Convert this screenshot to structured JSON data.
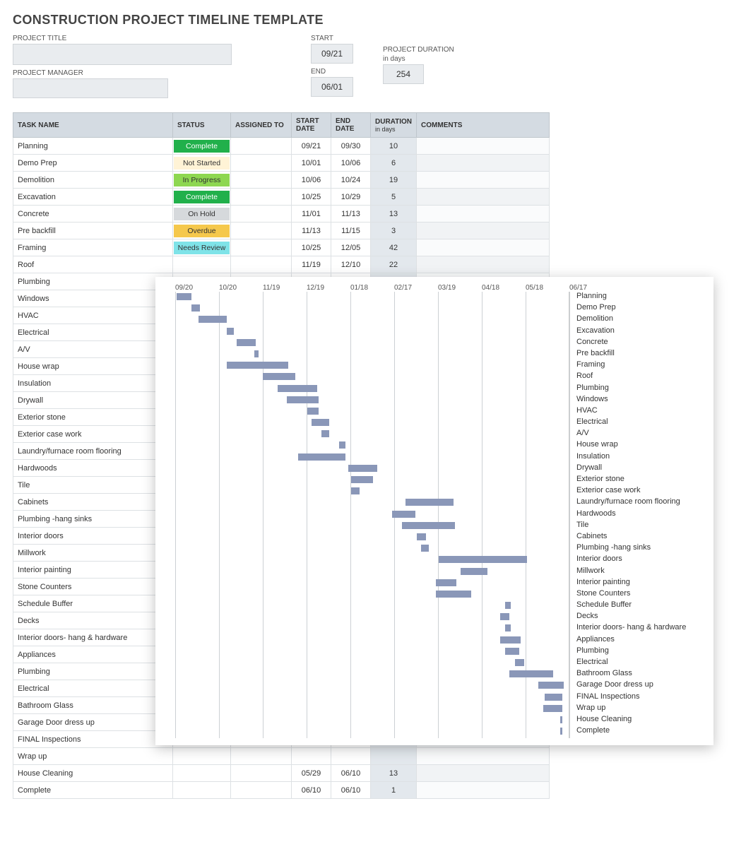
{
  "title": "CONSTRUCTION PROJECT TIMELINE TEMPLATE",
  "labels": {
    "project_title": "PROJECT TITLE",
    "project_manager": "PROJECT MANAGER",
    "start": "START",
    "end": "END",
    "project_duration": "PROJECT DURATION",
    "in_days": "in days"
  },
  "values": {
    "project_title": "",
    "project_manager": "",
    "start": "09/21",
    "end": "06/01",
    "duration": "254"
  },
  "headers": {
    "task_name": "TASK NAME",
    "status": "STATUS",
    "assigned_to": "ASSIGNED TO",
    "start_date": "START DATE",
    "end_date": "END DATE",
    "duration": "DURATION",
    "duration_sub": "in days",
    "comments": "COMMENTS"
  },
  "status_labels": {
    "complete": "Complete",
    "notstarted": "Not Started",
    "inprogress": "In Progress",
    "onhold": "On Hold",
    "overdue": "Overdue",
    "needsreview": "Needs Review"
  },
  "tasks": [
    {
      "name": "Planning",
      "status": "complete",
      "start": "09/21",
      "end": "09/30",
      "dur": "10"
    },
    {
      "name": "Demo Prep",
      "status": "notstarted",
      "start": "10/01",
      "end": "10/06",
      "dur": "6"
    },
    {
      "name": "Demolition",
      "status": "inprogress",
      "start": "10/06",
      "end": "10/24",
      "dur": "19"
    },
    {
      "name": "Excavation",
      "status": "complete",
      "start": "10/25",
      "end": "10/29",
      "dur": "5"
    },
    {
      "name": "Concrete",
      "status": "onhold",
      "start": "11/01",
      "end": "11/13",
      "dur": "13"
    },
    {
      "name": "Pre backfill",
      "status": "overdue",
      "start": "11/13",
      "end": "11/15",
      "dur": "3"
    },
    {
      "name": "Framing",
      "status": "needsreview",
      "start": "10/25",
      "end": "12/05",
      "dur": "42"
    },
    {
      "name": "Roof",
      "status": "",
      "start": "11/19",
      "end": "12/10",
      "dur": "22"
    },
    {
      "name": "Plumbing",
      "status": "",
      "start": "",
      "end": "",
      "dur": ""
    },
    {
      "name": "Windows",
      "status": "",
      "start": "",
      "end": "",
      "dur": ""
    },
    {
      "name": "HVAC",
      "status": "",
      "start": "",
      "end": "",
      "dur": ""
    },
    {
      "name": "Electrical",
      "status": "",
      "start": "",
      "end": "",
      "dur": ""
    },
    {
      "name": "A/V",
      "status": "",
      "start": "",
      "end": "",
      "dur": ""
    },
    {
      "name": "House wrap",
      "status": "",
      "start": "",
      "end": "",
      "dur": ""
    },
    {
      "name": "Insulation",
      "status": "",
      "start": "",
      "end": "",
      "dur": ""
    },
    {
      "name": "Drywall",
      "status": "",
      "start": "",
      "end": "",
      "dur": ""
    },
    {
      "name": "Exterior stone",
      "status": "",
      "start": "",
      "end": "",
      "dur": ""
    },
    {
      "name": "Exterior case work",
      "status": "",
      "start": "",
      "end": "",
      "dur": ""
    },
    {
      "name": "Laundry/furnace room flooring",
      "status": "",
      "start": "",
      "end": "",
      "dur": ""
    },
    {
      "name": "Hardwoods",
      "status": "",
      "start": "",
      "end": "",
      "dur": ""
    },
    {
      "name": "Tile",
      "status": "",
      "start": "",
      "end": "",
      "dur": ""
    },
    {
      "name": "Cabinets",
      "status": "",
      "start": "",
      "end": "",
      "dur": ""
    },
    {
      "name": "Plumbing -hang sinks",
      "status": "",
      "start": "",
      "end": "",
      "dur": ""
    },
    {
      "name": "Interior doors",
      "status": "",
      "start": "",
      "end": "",
      "dur": ""
    },
    {
      "name": "Millwork",
      "status": "",
      "start": "",
      "end": "",
      "dur": ""
    },
    {
      "name": "Interior painting",
      "status": "",
      "start": "",
      "end": "",
      "dur": ""
    },
    {
      "name": "Stone Counters",
      "status": "",
      "start": "",
      "end": "",
      "dur": ""
    },
    {
      "name": "Schedule Buffer",
      "status": "",
      "start": "",
      "end": "",
      "dur": ""
    },
    {
      "name": "Decks",
      "status": "",
      "start": "",
      "end": "",
      "dur": ""
    },
    {
      "name": "Interior doors- hang & hardware",
      "status": "",
      "start": "",
      "end": "",
      "dur": ""
    },
    {
      "name": "Appliances",
      "status": "",
      "start": "",
      "end": "",
      "dur": ""
    },
    {
      "name": "Plumbing",
      "status": "",
      "start": "",
      "end": "",
      "dur": ""
    },
    {
      "name": "Electrical",
      "status": "",
      "start": "",
      "end": "",
      "dur": ""
    },
    {
      "name": "Bathroom Glass",
      "status": "",
      "start": "",
      "end": "",
      "dur": ""
    },
    {
      "name": "Garage Door dress up",
      "status": "",
      "start": "",
      "end": "",
      "dur": ""
    },
    {
      "name": "FINAL Inspections",
      "status": "",
      "start": "",
      "end": "",
      "dur": ""
    },
    {
      "name": "Wrap up",
      "status": "",
      "start": "",
      "end": "",
      "dur": ""
    },
    {
      "name": "House Cleaning",
      "status": "",
      "start": "05/29",
      "end": "06/10",
      "dur": "13"
    },
    {
      "name": "Complete",
      "status": "",
      "start": "06/10",
      "end": "06/10",
      "dur": "1"
    }
  ],
  "chart_data": {
    "type": "gantt",
    "xlabels": [
      "09/20",
      "10/20",
      "11/19",
      "12/19",
      "01/18",
      "02/17",
      "03/19",
      "04/18",
      "05/18",
      "06/17"
    ],
    "xmin": 0,
    "xmax": 270,
    "items": [
      {
        "name": "Planning",
        "start": 1,
        "dur": 10
      },
      {
        "name": "Demo Prep",
        "start": 11,
        "dur": 6
      },
      {
        "name": "Demolition",
        "start": 16,
        "dur": 19
      },
      {
        "name": "Excavation",
        "start": 35,
        "dur": 5
      },
      {
        "name": "Concrete",
        "start": 42,
        "dur": 13
      },
      {
        "name": "Pre backfill",
        "start": 54,
        "dur": 3
      },
      {
        "name": "Framing",
        "start": 35,
        "dur": 42
      },
      {
        "name": "Roof",
        "start": 60,
        "dur": 22
      },
      {
        "name": "Plumbing",
        "start": 70,
        "dur": 27
      },
      {
        "name": "Windows",
        "start": 76,
        "dur": 22
      },
      {
        "name": "HVAC",
        "start": 90,
        "dur": 8
      },
      {
        "name": "Electrical",
        "start": 93,
        "dur": 12
      },
      {
        "name": "A/V",
        "start": 100,
        "dur": 5
      },
      {
        "name": "House wrap",
        "start": 112,
        "dur": 4
      },
      {
        "name": "Insulation",
        "start": 84,
        "dur": 32
      },
      {
        "name": "Drywall",
        "start": 118,
        "dur": 20
      },
      {
        "name": "Exterior stone",
        "start": 120,
        "dur": 15
      },
      {
        "name": "Exterior case work",
        "start": 120,
        "dur": 6
      },
      {
        "name": "Laundry/furnace room flooring",
        "start": 157,
        "dur": 33
      },
      {
        "name": "Hardwoods",
        "start": 148,
        "dur": 16
      },
      {
        "name": "Tile",
        "start": 155,
        "dur": 36
      },
      {
        "name": "Cabinets",
        "start": 165,
        "dur": 6
      },
      {
        "name": "Plumbing -hang sinks",
        "start": 168,
        "dur": 5
      },
      {
        "name": "Interior doors",
        "start": 180,
        "dur": 60
      },
      {
        "name": "Millwork",
        "start": 195,
        "dur": 18
      },
      {
        "name": "Interior painting",
        "start": 178,
        "dur": 14
      },
      {
        "name": "Stone Counters",
        "start": 178,
        "dur": 24
      },
      {
        "name": "Schedule Buffer",
        "start": 225,
        "dur": 4
      },
      {
        "name": "Decks",
        "start": 222,
        "dur": 6
      },
      {
        "name": "Interior doors- hang & hardware",
        "start": 225,
        "dur": 4
      },
      {
        "name": "Appliances",
        "start": 222,
        "dur": 14
      },
      {
        "name": "Plumbing",
        "start": 225,
        "dur": 10
      },
      {
        "name": "Electrical",
        "start": 232,
        "dur": 6
      },
      {
        "name": "Bathroom Glass",
        "start": 228,
        "dur": 30
      },
      {
        "name": "Garage Door dress up",
        "start": 248,
        "dur": 17
      },
      {
        "name": "FINAL Inspections",
        "start": 252,
        "dur": 12
      },
      {
        "name": "Wrap up",
        "start": 251,
        "dur": 13
      },
      {
        "name": "House Cleaning",
        "start": 263,
        "dur": 1
      },
      {
        "name": "Complete",
        "start": 263,
        "dur": 1
      }
    ]
  }
}
